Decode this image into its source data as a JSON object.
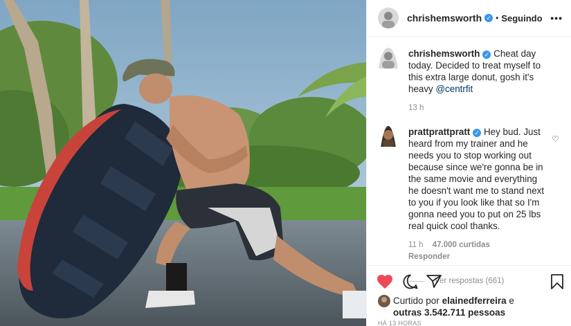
{
  "post": {
    "username": "chrishemsworth",
    "verified_icon": "verified-badge-icon",
    "follow_state": "Seguindo",
    "separator": "•",
    "more_icon": "more-options-icon"
  },
  "caption": {
    "username": "chrishemsworth",
    "text": "Cheat day today. Decided to treat myself to this extra large donut, gosh it's heavy",
    "mention": "@centrfit",
    "time": "13 h"
  },
  "comment": {
    "username": "prattprattpratt",
    "text": "Hey bud. Just heard from my trainer and he needs you to stop working out because since we're gonna be in the same movie and everything he doesn't want me to stand next to you if you look like that so I'm gonna need you to put on 25 lbs real quick cool thanks.",
    "time": "11 h",
    "likes": "47.000 curtidas",
    "reply": "Responder",
    "view_replies": "Ver respostas (661)"
  },
  "likes": {
    "prefix": "Curtido por",
    "user": "elainedferreira",
    "connector": "e",
    "others": "outras 3.542.711 pessoas"
  },
  "timestamp": "HÁ 13 HORAS",
  "colors": {
    "like_red": "#ed4956",
    "link": "#00376b",
    "verified": "#3897f0",
    "muted": "#8e8e8e"
  }
}
